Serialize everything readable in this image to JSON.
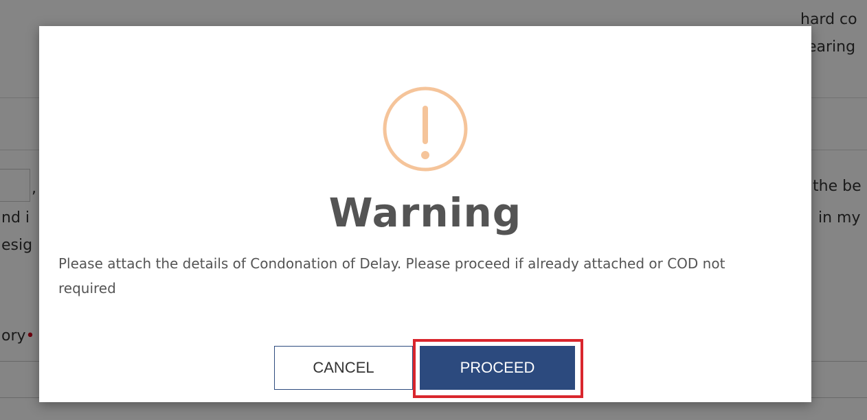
{
  "background": {
    "fragments": [
      {
        "name": "bg-text-top-right-1",
        "text": "hard co"
      },
      {
        "name": "bg-text-top-right-2",
        "text": "earing"
      },
      {
        "name": "bg-text-right-1",
        "text": "the be"
      },
      {
        "name": "bg-text-right-2",
        "text": "in my"
      },
      {
        "name": "bg-text-left-1",
        "text": ","
      },
      {
        "name": "bg-text-left-2",
        "text": "nd i"
      },
      {
        "name": "bg-text-left-3",
        "text": "esig"
      },
      {
        "name": "bg-text-left-4",
        "text": "ory"
      }
    ],
    "required_marker": "•"
  },
  "dialog": {
    "icon": "exclamation-circle-icon",
    "icon_color": "#f5c49a",
    "title": "Warning",
    "message": "Please attach the details of Condonation of Delay. Please proceed if already attached or COD not required",
    "cancel_label": "CANCEL",
    "proceed_label": "PROCEED",
    "primary_color": "#2c4a7e",
    "highlight_color": "#d9262d"
  }
}
